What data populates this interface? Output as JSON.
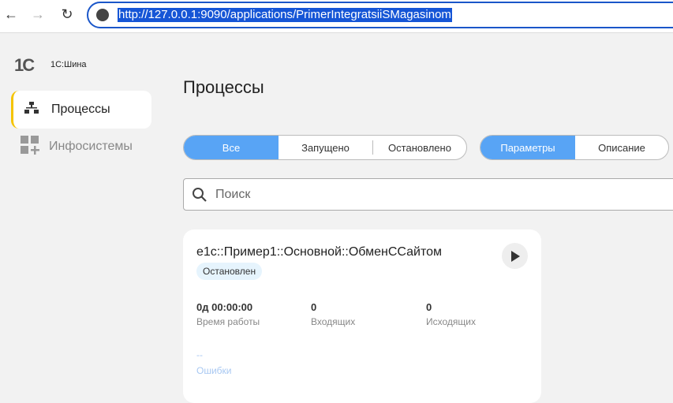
{
  "browser": {
    "url": "http://127.0.0.1:9090/applications/PrimerIntegratsiiSMagasinom"
  },
  "app": {
    "logo": "1C",
    "name": "1С:Шина"
  },
  "sidebar": {
    "items": [
      {
        "label": "Процессы",
        "active": true
      },
      {
        "label": "Инфосистемы",
        "active": false
      }
    ]
  },
  "main": {
    "title": "Процессы",
    "filter": [
      "Все",
      "Запущено",
      "Остановлено"
    ],
    "view": [
      "Параметры",
      "Описание"
    ],
    "search": {
      "placeholder": "Поиск"
    },
    "card": {
      "title": "e1c::Пример1::Основной::ОбменССайтом",
      "status": "Остановлен",
      "stats": [
        {
          "value": "0д 00:00:00",
          "label": "Время работы"
        },
        {
          "value": "0",
          "label": "Входящих"
        },
        {
          "value": "0",
          "label": "Исходящих"
        }
      ],
      "errors": {
        "value": "--",
        "label": "Ошибки"
      }
    }
  },
  "colors": {
    "accent": "#58a4f5",
    "active_marker": "#f5c400"
  }
}
